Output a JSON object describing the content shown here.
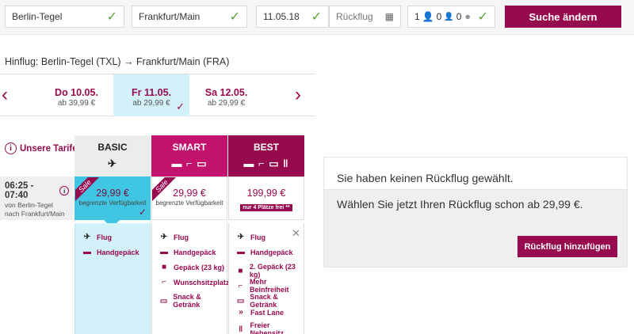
{
  "search": {
    "origin": "Berlin-Tegel",
    "destination": "Frankfurt/Main",
    "date": "11.05.18",
    "return_placeholder": "Rückflug",
    "passengers": {
      "adults": "1",
      "children": "0",
      "infants": "0"
    },
    "submit_label": "Suche ändern"
  },
  "route": {
    "title": "Hinflug: Berlin-Tegel (TXL) → Frankfurt/Main (FRA)"
  },
  "dates": [
    {
      "day": "Do 10.05.",
      "price": "ab 39,99 €"
    },
    {
      "day": "Fr 11.05.",
      "price": "ab 29,99 €",
      "selected": true
    },
    {
      "day": "Sa 12.05.",
      "price": "ab 29,99 €"
    }
  ],
  "tariffs": {
    "link_label": "Unsere Tarife",
    "basic": {
      "name": "BASIC",
      "price": "29,99 €",
      "note": "begrenzte Verfügbarkeit",
      "sale": "Sale"
    },
    "smart": {
      "name": "SMART",
      "price": "29,99 €",
      "note": "begrenzte Verfügbarkeit",
      "sale": "Sale"
    },
    "best": {
      "name": "BEST",
      "price": "199,99 €",
      "note": "nur 4 Plätze frei **"
    }
  },
  "flight": {
    "time": "06:25 - 07:40",
    "from": "von Berlin-Tegel",
    "to": "nach Frankfurt/Main"
  },
  "features": {
    "basic": [
      "Flug",
      "Handgepäck"
    ],
    "smart": [
      "Flug",
      "Handgepäck",
      "Gepäck (23 kg)",
      "Wunschsitzplatz",
      "Snack & Getränk"
    ],
    "best": [
      "Flug",
      "Handgepäck",
      "2. Gepäck (23 kg)",
      "Mehr Beinfreiheit",
      "Snack & Getränk",
      "Fast Lane",
      "Freier Nebensitz"
    ]
  },
  "return_box": {
    "title": "Sie haben keinen Rückflug gewählt.",
    "text": "Wählen Sie jetzt Ihren Rückflug schon ab 29,99 €.",
    "button": "Rückflug hinzufügen"
  },
  "colors": {
    "brand": "#980a4e",
    "brand_light": "#c2126d",
    "selected_bg": "#d2f1f8",
    "basic_cell": "#40c6e2",
    "ok": "#5aa33a"
  }
}
